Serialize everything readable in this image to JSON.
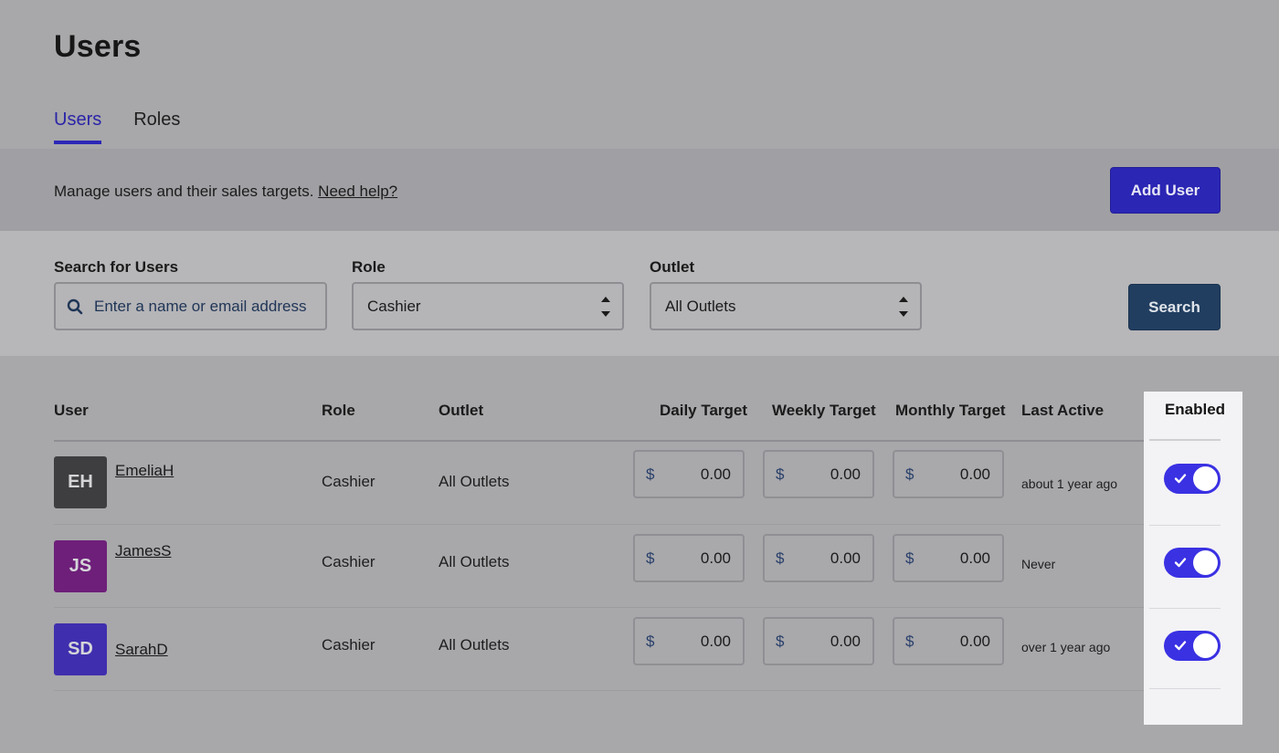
{
  "page": {
    "title": "Users"
  },
  "tabs": [
    {
      "label": "Users",
      "active": true
    },
    {
      "label": "Roles",
      "active": false
    }
  ],
  "info": {
    "text": "Manage users and their sales targets.",
    "help_link": "Need help?",
    "add_user_label": "Add User"
  },
  "filters": {
    "search_label": "Search for Users",
    "search_placeholder": "Enter a name or email address",
    "role_label": "Role",
    "role_value": "Cashier",
    "outlet_label": "Outlet",
    "outlet_value": "All Outlets",
    "search_button": "Search"
  },
  "table": {
    "headers": {
      "user": "User",
      "role": "Role",
      "outlet": "Outlet",
      "daily": "Daily Target",
      "weekly": "Weekly Target",
      "monthly": "Monthly Target",
      "last_active": "Last Active",
      "enabled": "Enabled"
    },
    "currency": "$",
    "rows": [
      {
        "initials": "EH",
        "avatar_color": "#3e3e40",
        "name": "EmeliaH",
        "role": "Cashier",
        "outlet": "All Outlets",
        "daily": "0.00",
        "weekly": "0.00",
        "monthly": "0.00",
        "last_active": "about 1 year ago",
        "enabled": true
      },
      {
        "initials": "JS",
        "avatar_color": "#6e1f7a",
        "name": "JamesS",
        "role": "Cashier",
        "outlet": "All Outlets",
        "daily": "0.00",
        "weekly": "0.00",
        "monthly": "0.00",
        "last_active": "Never",
        "enabled": true
      },
      {
        "initials": "SD",
        "avatar_color": "#3f2fae",
        "name": "SarahD",
        "role": "Cashier",
        "outlet": "All Outlets",
        "daily": "0.00",
        "weekly": "0.00",
        "monthly": "0.00",
        "last_active": "over 1 year ago",
        "enabled": true
      }
    ]
  },
  "colors": {
    "accent": "#2b26b4",
    "toggle_on": "#3a31e3",
    "search_button": "#213e60"
  }
}
